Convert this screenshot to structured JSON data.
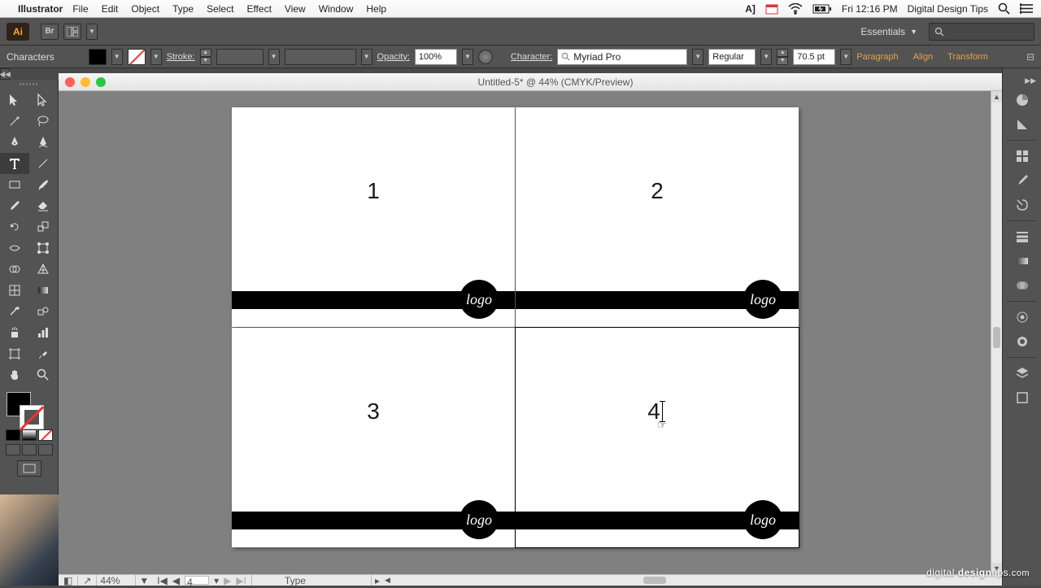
{
  "menubar": {
    "app": "Illustrator",
    "items": [
      "File",
      "Edit",
      "Object",
      "Type",
      "Select",
      "Effect",
      "View",
      "Window",
      "Help"
    ],
    "clock": "Fri 12:16 PM",
    "user": "Digital Design Tips"
  },
  "appbar": {
    "workspace": "Essentials"
  },
  "control": {
    "mode_label": "Characters",
    "stroke_label": "Stroke:",
    "opacity_label": "Opacity:",
    "opacity_value": "100%",
    "character_label": "Character:",
    "font_family": "Myriad Pro",
    "font_style": "Regular",
    "font_size": "70.5 pt",
    "paragraph": "Paragraph",
    "align": "Align",
    "transform": "Transform"
  },
  "document": {
    "title": "Untitled-5* @ 44% (CMYK/Preview)",
    "artboards": [
      {
        "num": "1",
        "logo": "logo"
      },
      {
        "num": "2",
        "logo": "logo"
      },
      {
        "num": "3",
        "logo": "logo"
      },
      {
        "num": "4",
        "logo": "logo"
      }
    ]
  },
  "status": {
    "zoom": "44%",
    "page": "4",
    "mode": "Type"
  },
  "watermark": {
    "a": "digital ",
    "b": "design",
    "c": "tips",
    "d": ".com"
  }
}
